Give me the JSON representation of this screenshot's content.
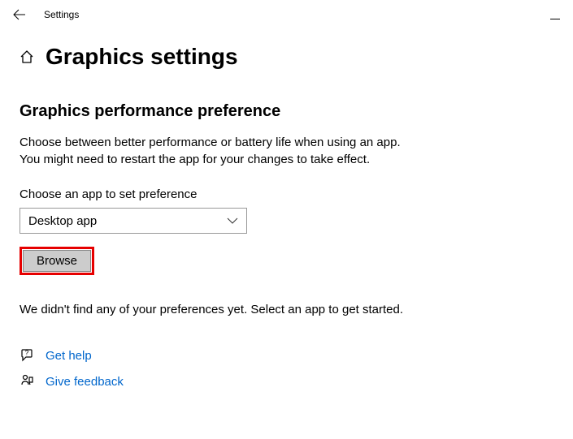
{
  "window": {
    "title": "Settings"
  },
  "header": {
    "page_title": "Graphics settings"
  },
  "section": {
    "title": "Graphics performance preference",
    "description_line1": "Choose between better performance or battery life when using an app.",
    "description_line2": "You might need to restart the app for your changes to take effect.",
    "dropdown_label": "Choose an app to set preference",
    "dropdown_value": "Desktop app",
    "browse_label": "Browse",
    "empty_state": "We didn't find any of your preferences yet. Select an app to get started."
  },
  "footer": {
    "get_help": "Get help",
    "give_feedback": "Give feedback"
  }
}
